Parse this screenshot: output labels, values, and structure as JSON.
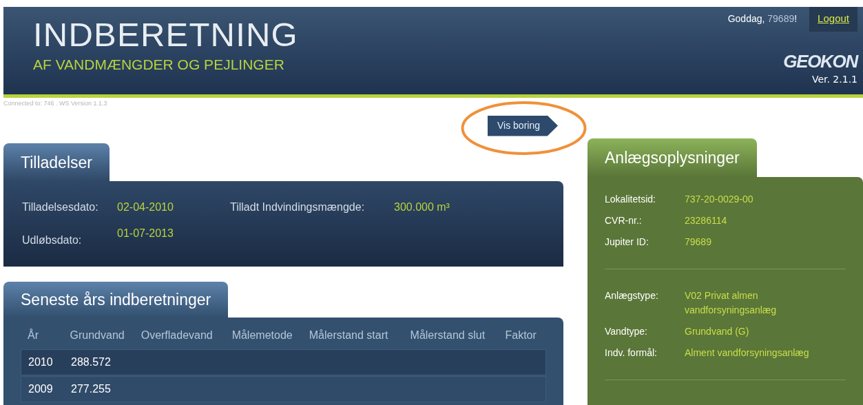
{
  "header": {
    "title": "INDBERETNING",
    "subtitle": "AF VANDMÆNGDER OG PEJLINGER",
    "greeting": "Goddag,",
    "user": "79689",
    "greeting_end": "!",
    "logout": "Logout",
    "logo": "GEOKON",
    "version": "Ver. 2.1.1"
  },
  "connection": "Connected to: 746 . WS Version 1.1.3",
  "vis_boring": "Vis boring",
  "permits": {
    "title": "Tilladelser",
    "fields": [
      {
        "label": "Tilladelsesdato:",
        "value": "02-04-2010"
      },
      {
        "label": "Tilladt Indvindingsmængde:",
        "value": "300.000 m³"
      },
      {
        "label": "Udløbsdato:",
        "value": "01-07-2013"
      }
    ]
  },
  "reports": {
    "title": "Seneste års indberetninger",
    "columns": [
      "År",
      "Grundvand",
      "Overfladevand",
      "Målemetode",
      "Målerstand start",
      "Målerstand slut",
      "Faktor"
    ],
    "rows": [
      [
        "2010",
        "288.572"
      ],
      [
        "2009",
        "277.255"
      ]
    ]
  },
  "facility": {
    "title": "Anlægsoplysninger",
    "groups": [
      [
        {
          "label": "Lokalitetsid:",
          "value": "737-20-0029-00"
        },
        {
          "label": "CVR-nr.:",
          "value": "23286114"
        },
        {
          "label": "Jupiter ID:",
          "value": "79689"
        }
      ],
      [
        {
          "label": "Anlægstype:",
          "value": "V02 Privat almen vandforsyningsanlæg"
        },
        {
          "label": "Vandtype:",
          "value": "Grundvand (G)"
        },
        {
          "label": "Indv. formål:",
          "value": "Alment vandforsyningsanlæg"
        }
      ]
    ]
  }
}
